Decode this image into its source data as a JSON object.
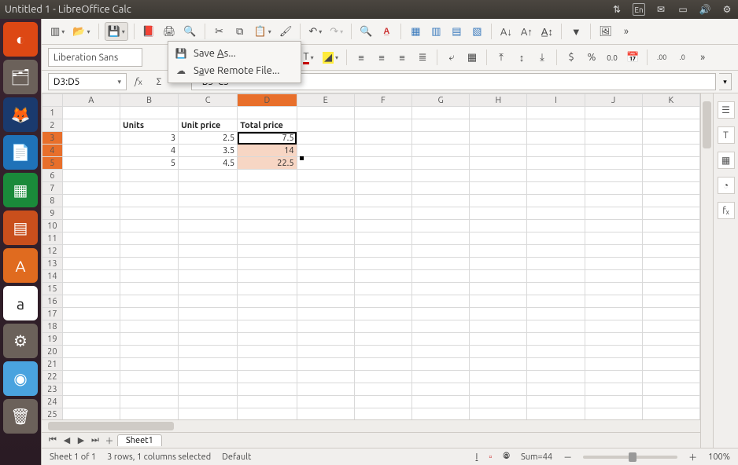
{
  "window": {
    "title": "Untitled 1 - LibreOffice Calc"
  },
  "tray": {
    "lang": "En"
  },
  "launcher": [
    {
      "name": "dash",
      "glyph": "◐",
      "bg": "#dd4814"
    },
    {
      "name": "files",
      "glyph": "🗂",
      "bg": "#6b615a"
    },
    {
      "name": "firefox",
      "glyph": "🦊",
      "bg": "#1a3a6e"
    },
    {
      "name": "writer",
      "glyph": "📄",
      "bg": "#1f72b8"
    },
    {
      "name": "calc",
      "glyph": "▦",
      "bg": "#1a8a3a"
    },
    {
      "name": "impress",
      "glyph": "▤",
      "bg": "#c94f1c"
    },
    {
      "name": "software",
      "glyph": "A",
      "bg": "#e06b1f"
    },
    {
      "name": "amazon",
      "glyph": "a",
      "bg": "#ffffff"
    },
    {
      "name": "settings",
      "glyph": "⚙",
      "bg": "#6b615a"
    },
    {
      "name": "help",
      "glyph": "◉",
      "bg": "#4aa3df"
    },
    {
      "name": "trash",
      "glyph": "🗑",
      "bg": "#6b615a"
    }
  ],
  "toolbar2": {
    "font_name": "Liberation Sans"
  },
  "save_menu": {
    "item1": "Save As...",
    "item1_mnemonic_index": 5,
    "item2_pre": "S",
    "item2_mid": "a",
    "item2_post": "ve Remote File..."
  },
  "formula": {
    "namebox": "D3:D5",
    "content": "=B3*C3"
  },
  "columns": [
    "A",
    "B",
    "C",
    "D",
    "E",
    "F",
    "G",
    "H",
    "I",
    "J",
    "K"
  ],
  "rows": 26,
  "cells": {
    "B2": "Units",
    "C2": "Unit price",
    "D2": "Total price",
    "B3": "3",
    "C3": "2.5",
    "D3": "7.5",
    "B4": "4",
    "C4": "3.5",
    "D4": "14",
    "B5": "5",
    "C5": "4.5",
    "D5": "22.5"
  },
  "tabs": {
    "sheet1": "Sheet1"
  },
  "status": {
    "sheet": "Sheet 1 of 1",
    "selection": "3 rows, 1 columns selected",
    "style": "Default",
    "sum": "Sum=44",
    "zoom": "100%"
  },
  "sidebar_icons": [
    "☰",
    "T",
    "▦",
    "◔",
    "fₓ"
  ]
}
